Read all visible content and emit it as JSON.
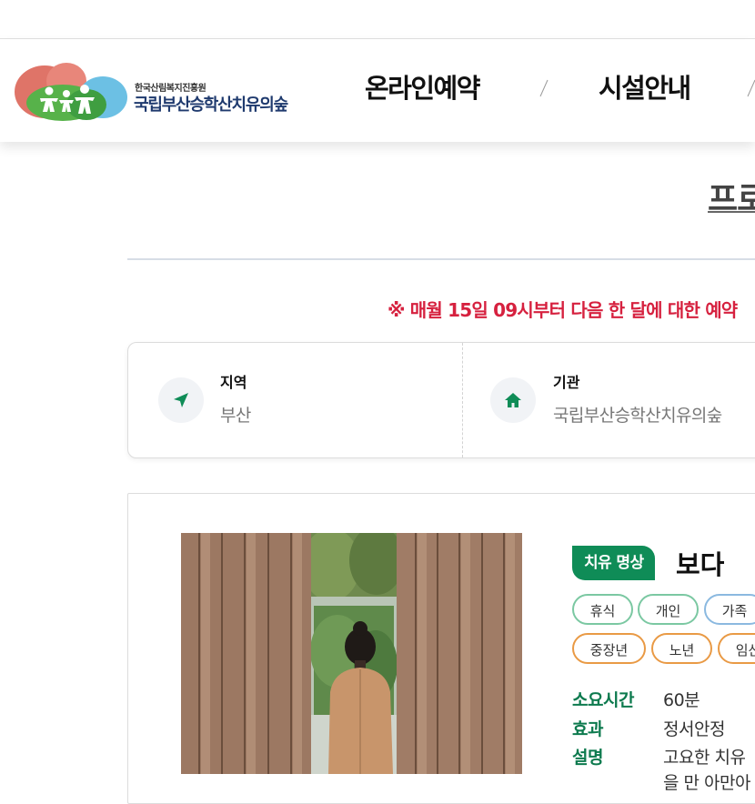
{
  "header": {
    "logo_subtitle": "한국산림복지진흥원",
    "logo_name": "국립부산승학산치유의숲",
    "nav": [
      "온라인예약",
      "시설안내"
    ]
  },
  "page": {
    "title": "프로",
    "notice": "※ 매월 15일 09시부터 다음 한 달에 대한 예약"
  },
  "info": [
    {
      "label": "지역",
      "value": "부산",
      "icon": "location-arrow-icon"
    },
    {
      "label": "기관",
      "value": "국립부산승학산치유의숲",
      "icon": "home-icon"
    }
  ],
  "program": {
    "category": "치유 명상",
    "title": "보다",
    "tags_row1": [
      "휴식",
      "개인",
      "가족"
    ],
    "tags_row2": [
      "중장년",
      "노년",
      "임산"
    ],
    "meta": [
      {
        "key": "소요시간",
        "value": "60분"
      },
      {
        "key": "효과",
        "value": "정서안정"
      },
      {
        "key": "설명",
        "value": "고요한 치유"
      }
    ],
    "desc_line2": "을 만 아만아"
  },
  "colors": {
    "accent_green": "#0f8c57",
    "notice_red": "#d6213f",
    "tag_green": "#7bc8a2",
    "tag_blue": "#8bb9e0",
    "tag_orange": "#e99a45"
  }
}
